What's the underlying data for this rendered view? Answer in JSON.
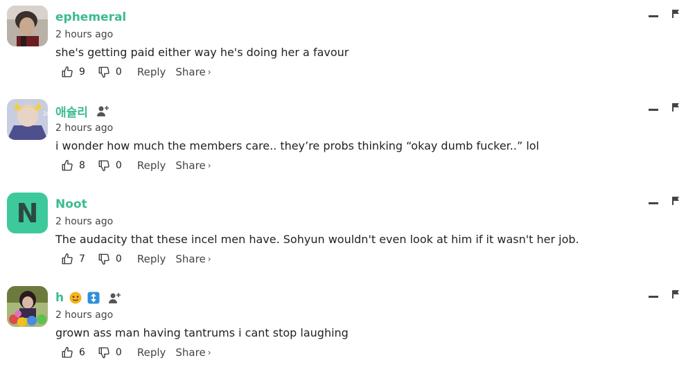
{
  "comments": [
    {
      "username": "ephemeral",
      "timestamp": "2 hours ago",
      "text": "she's getting paid either way he's doing her a favour",
      "likes": "9",
      "dislikes": "0",
      "reply_label": "Reply",
      "share_label": "Share",
      "avatar": "photo-avatar",
      "has_follow_icon": false
    },
    {
      "username": "애슐리",
      "timestamp": "2 hours ago",
      "text": "i wonder how much the members care.. they’re probs thinking “okay dumb fucker..” lol",
      "likes": "8",
      "dislikes": "0",
      "reply_label": "Reply",
      "share_label": "Share",
      "avatar": "photo-avatar",
      "has_follow_icon": true
    },
    {
      "username": "Noot",
      "timestamp": "2 hours ago",
      "text": "The audacity that these incel men have. Sohyun wouldn't even look at him if it wasn't her job.",
      "likes": "7",
      "dislikes": "0",
      "reply_label": "Reply",
      "share_label": "Share",
      "avatar_letter": "N",
      "has_follow_icon": false
    },
    {
      "username": "h",
      "timestamp": "2 hours ago",
      "text": "grown ass man having tantrums i cant stop laughing",
      "likes": "6",
      "dislikes": "0",
      "reply_label": "Reply",
      "share_label": "Share",
      "avatar": "photo-avatar",
      "badges": [
        "emoji-face-badge",
        "up-down-arrow-badge"
      ],
      "has_follow_icon": true
    }
  ],
  "icons": {
    "like": "thumbs-up-icon",
    "dislike": "thumbs-down-icon",
    "share_chevron": "›",
    "collapse": "minus-icon",
    "flag": "flag-icon",
    "follow": "add-user-icon"
  },
  "colors": {
    "username": "#3dbb8f",
    "avatar_letter_bg": "#3ec99c",
    "avatar_letter_fg": "#2b4a40",
    "text": "#222222"
  }
}
